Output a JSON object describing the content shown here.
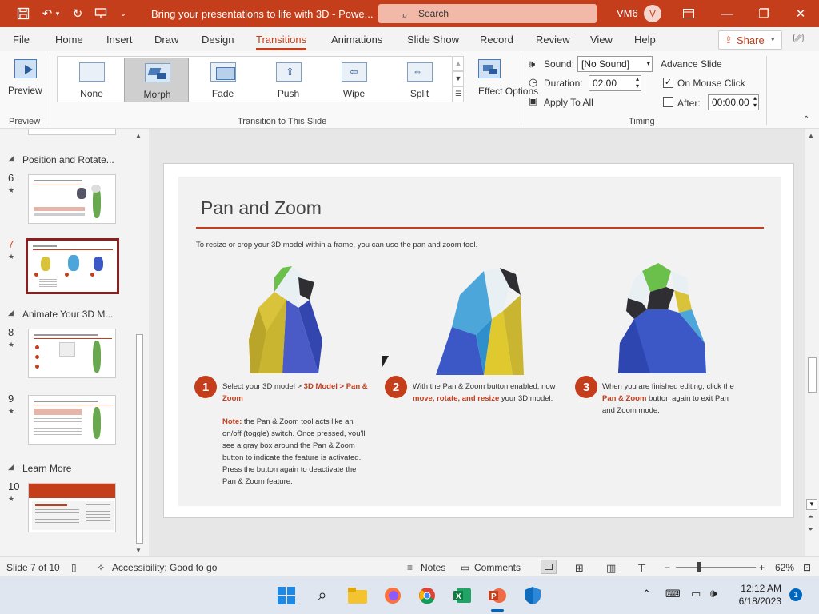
{
  "titlebar": {
    "doc_title": "Bring your presentations to life with 3D  -  Powe...",
    "search_placeholder": "Search",
    "user_initials": "VM6",
    "avatar_letter": "V"
  },
  "tabs": [
    "File",
    "Home",
    "Insert",
    "Draw",
    "Design",
    "Transitions",
    "Animations",
    "Slide Show",
    "Record",
    "Review",
    "View",
    "Help"
  ],
  "active_tab": "Transitions",
  "share_label": "Share",
  "ribbon": {
    "preview_label": "Preview",
    "preview_group": "Preview",
    "transitions": [
      "None",
      "Morph",
      "Fade",
      "Push",
      "Wipe",
      "Split"
    ],
    "selected_transition": "Morph",
    "effect_options": "Effect Options",
    "transition_group": "Transition to This Slide",
    "sound_label": "Sound:",
    "sound_value": "[No Sound]",
    "duration_label": "Duration:",
    "duration_value": "02.00",
    "apply_all": "Apply To All",
    "advance_slide": "Advance Slide",
    "on_mouse_click": "On Mouse Click",
    "after_label": "After:",
    "after_value": "00:00.00",
    "timing_group": "Timing"
  },
  "slides_panel": {
    "sections": [
      "Position and Rotate...",
      "Animate Your 3D M...",
      "Learn More"
    ],
    "slide_numbers": [
      "6",
      "7",
      "8",
      "9",
      "10"
    ],
    "star": "★",
    "selected_slide": "7"
  },
  "slide": {
    "title": "Pan and Zoom",
    "intro": "To resize or crop your 3D model within a frame, you can use the pan and zoom tool.",
    "steps": [
      {
        "num": "1",
        "text_a": "Select your 3D model > ",
        "hl_a": "3D Model",
        "text_b": " > ",
        "hl_b": "Pan & Zoom"
      },
      {
        "num": "2",
        "text_a": "With the Pan & Zoom button enabled, now ",
        "hl_a": "move, rotate, and resize",
        "text_b": " your 3D model."
      },
      {
        "num": "3",
        "text_a": "When you are finished editing, click the ",
        "hl_a": "Pan & Zoom",
        "text_b": " button again to exit Pan and Zoom mode."
      }
    ],
    "note_label": "Note:",
    "note_text": " the Pan & Zoom tool acts like an on/off (toggle) switch. Once pressed, you'll see a gray box around the Pan & Zoom button to indicate the feature is activated. Press the button again to deactivate the Pan & Zoom feature."
  },
  "status": {
    "slide_of": "Slide 7 of 10",
    "accessibility": "Accessibility: Good to go",
    "notes": "Notes",
    "comments": "Comments",
    "zoom_minus": "−",
    "zoom_plus": "+",
    "zoom": "62%"
  },
  "taskbar": {
    "time": "12:12 AM",
    "date": "6/18/2023",
    "badge": "1"
  },
  "colors": {
    "accent": "#c43e1c",
    "selected_border": "#8b1e1e"
  }
}
